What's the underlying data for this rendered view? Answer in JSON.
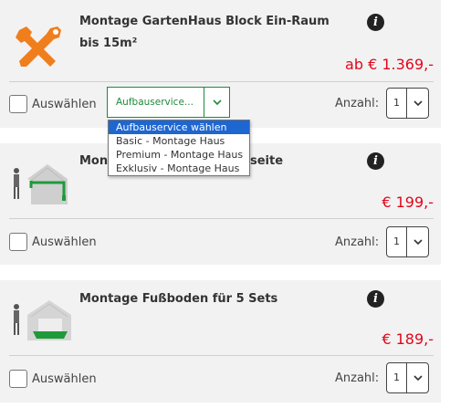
{
  "products": [
    {
      "title": "Montage GartenHaus Block Ein-Raum bis 15m²",
      "price": "ab € 1.369,-",
      "select_label": "Auswählen",
      "service_select": {
        "value": "Aufbauservice...",
        "options": [
          "Aufbauservice wählen",
          "Basic - Montage Haus",
          "Premium - Montage Haus",
          "Exklusiv - Montage Haus"
        ]
      },
      "qty_label": "Anzahl:",
      "qty_value": "1",
      "icon": "tools-icon"
    },
    {
      "title_start": "Mont",
      "title_end": "seite",
      "price": "€ 199,-",
      "select_label": "Auswählen",
      "qty_label": "Anzahl:",
      "qty_value": "1",
      "icon": "house-gutter-icon"
    },
    {
      "title": "Montage Fußboden für 5 Sets",
      "price": "€ 189,-",
      "select_label": "Auswählen",
      "qty_label": "Anzahl:",
      "qty_value": "1",
      "icon": "house-floor-icon"
    }
  ],
  "colors": {
    "price": "#e0071b",
    "accent_green": "#1f8a3b",
    "card_bg": "#f2f2f2",
    "selected_option": "#1e66d0"
  }
}
